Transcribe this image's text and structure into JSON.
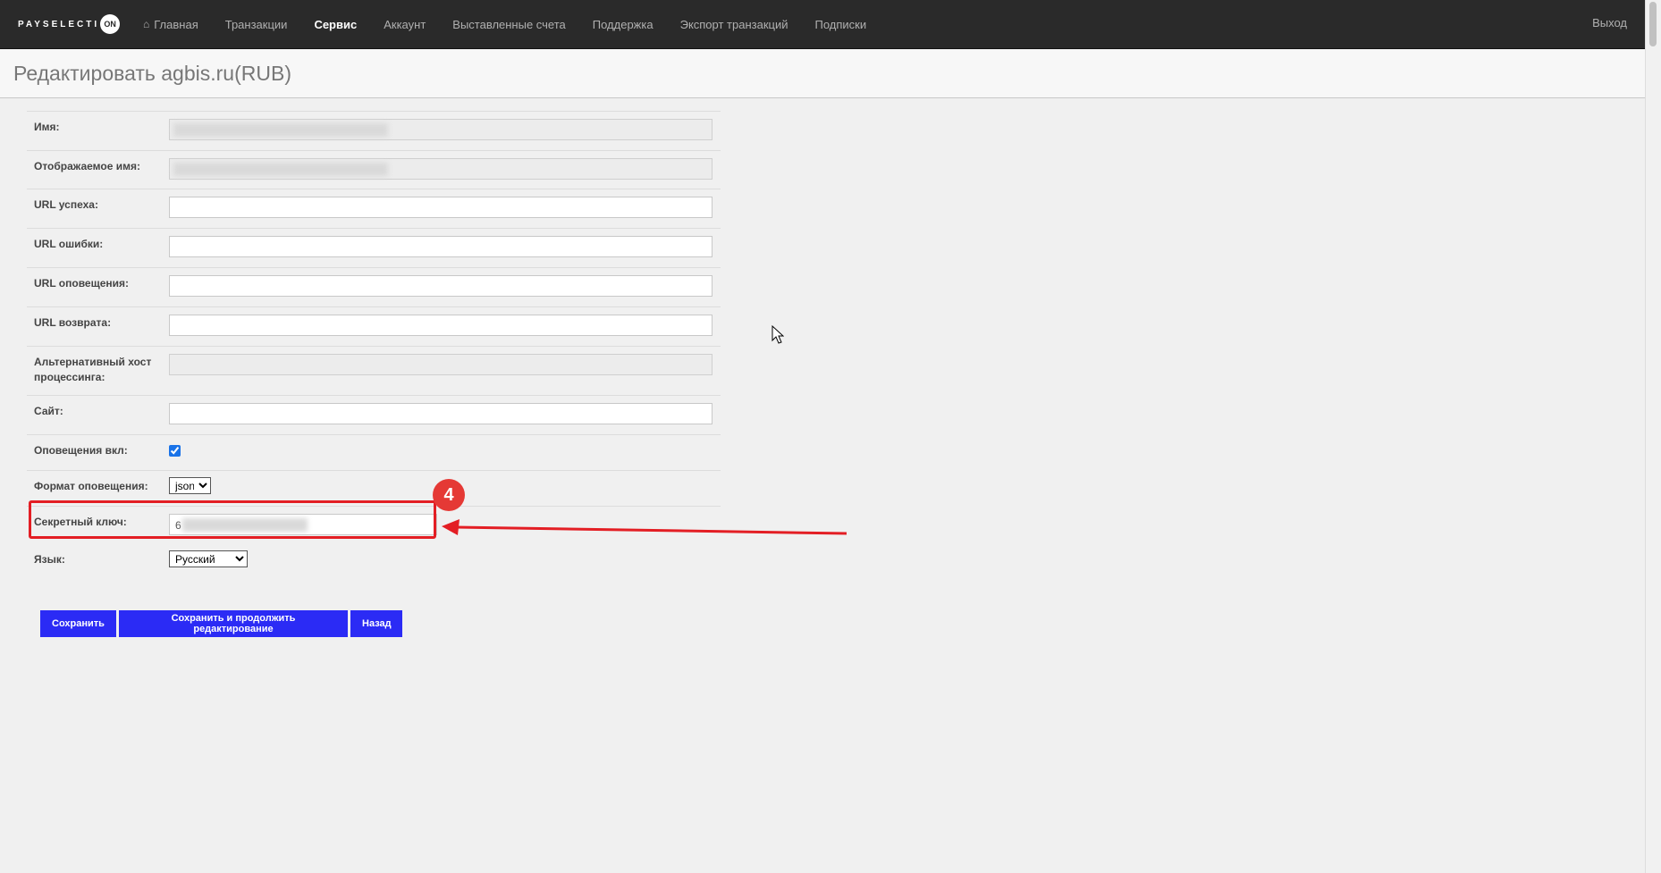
{
  "brand": {
    "logo_text": "PAYSELECTI",
    "logo_on": "ON"
  },
  "nav": {
    "items": [
      {
        "label": "Главная",
        "icon": "home-icon",
        "active": false
      },
      {
        "label": "Транзакции",
        "active": false
      },
      {
        "label": "Сервис",
        "active": true
      },
      {
        "label": "Аккаунт",
        "active": false
      },
      {
        "label": "Выставленные счета",
        "active": false
      },
      {
        "label": "Поддержка",
        "active": false
      },
      {
        "label": "Экспорт транзакций",
        "active": false
      },
      {
        "label": "Подписки",
        "active": false
      }
    ],
    "logout": "Выход"
  },
  "page": {
    "title": "Редактировать agbis.ru(RUB)"
  },
  "form": {
    "name": {
      "label": "Имя:",
      "value": ""
    },
    "display_name": {
      "label": "Отображаемое имя:",
      "value": ""
    },
    "success_url": {
      "label": "URL успеха:",
      "value": ""
    },
    "error_url": {
      "label": "URL ошибки:",
      "value": ""
    },
    "notify_url": {
      "label": "URL оповещения:",
      "value": ""
    },
    "return_url": {
      "label": "URL возврата:",
      "value": ""
    },
    "alt_host": {
      "label": "Альтернативный хост процессинга:",
      "value": ""
    },
    "site": {
      "label": "Сайт:",
      "value": ""
    },
    "notify_enabled": {
      "label": "Оповещения вкл:",
      "checked": true
    },
    "notify_format": {
      "label": "Формат оповещения:",
      "value": "json"
    },
    "secret_key": {
      "label": "Секретный ключ:",
      "value": "6"
    },
    "language": {
      "label": "Язык:",
      "value": "Русский"
    }
  },
  "buttons": {
    "save": "Сохранить",
    "save_continue": "Сохранить и продолжить редактирование",
    "back": "Назад"
  },
  "annotation": {
    "badge": "4",
    "color": "#e31e24"
  },
  "colors": {
    "navbar": "#2a2a2a",
    "button": "#2b2bf5",
    "background": "#f0f0f0"
  }
}
